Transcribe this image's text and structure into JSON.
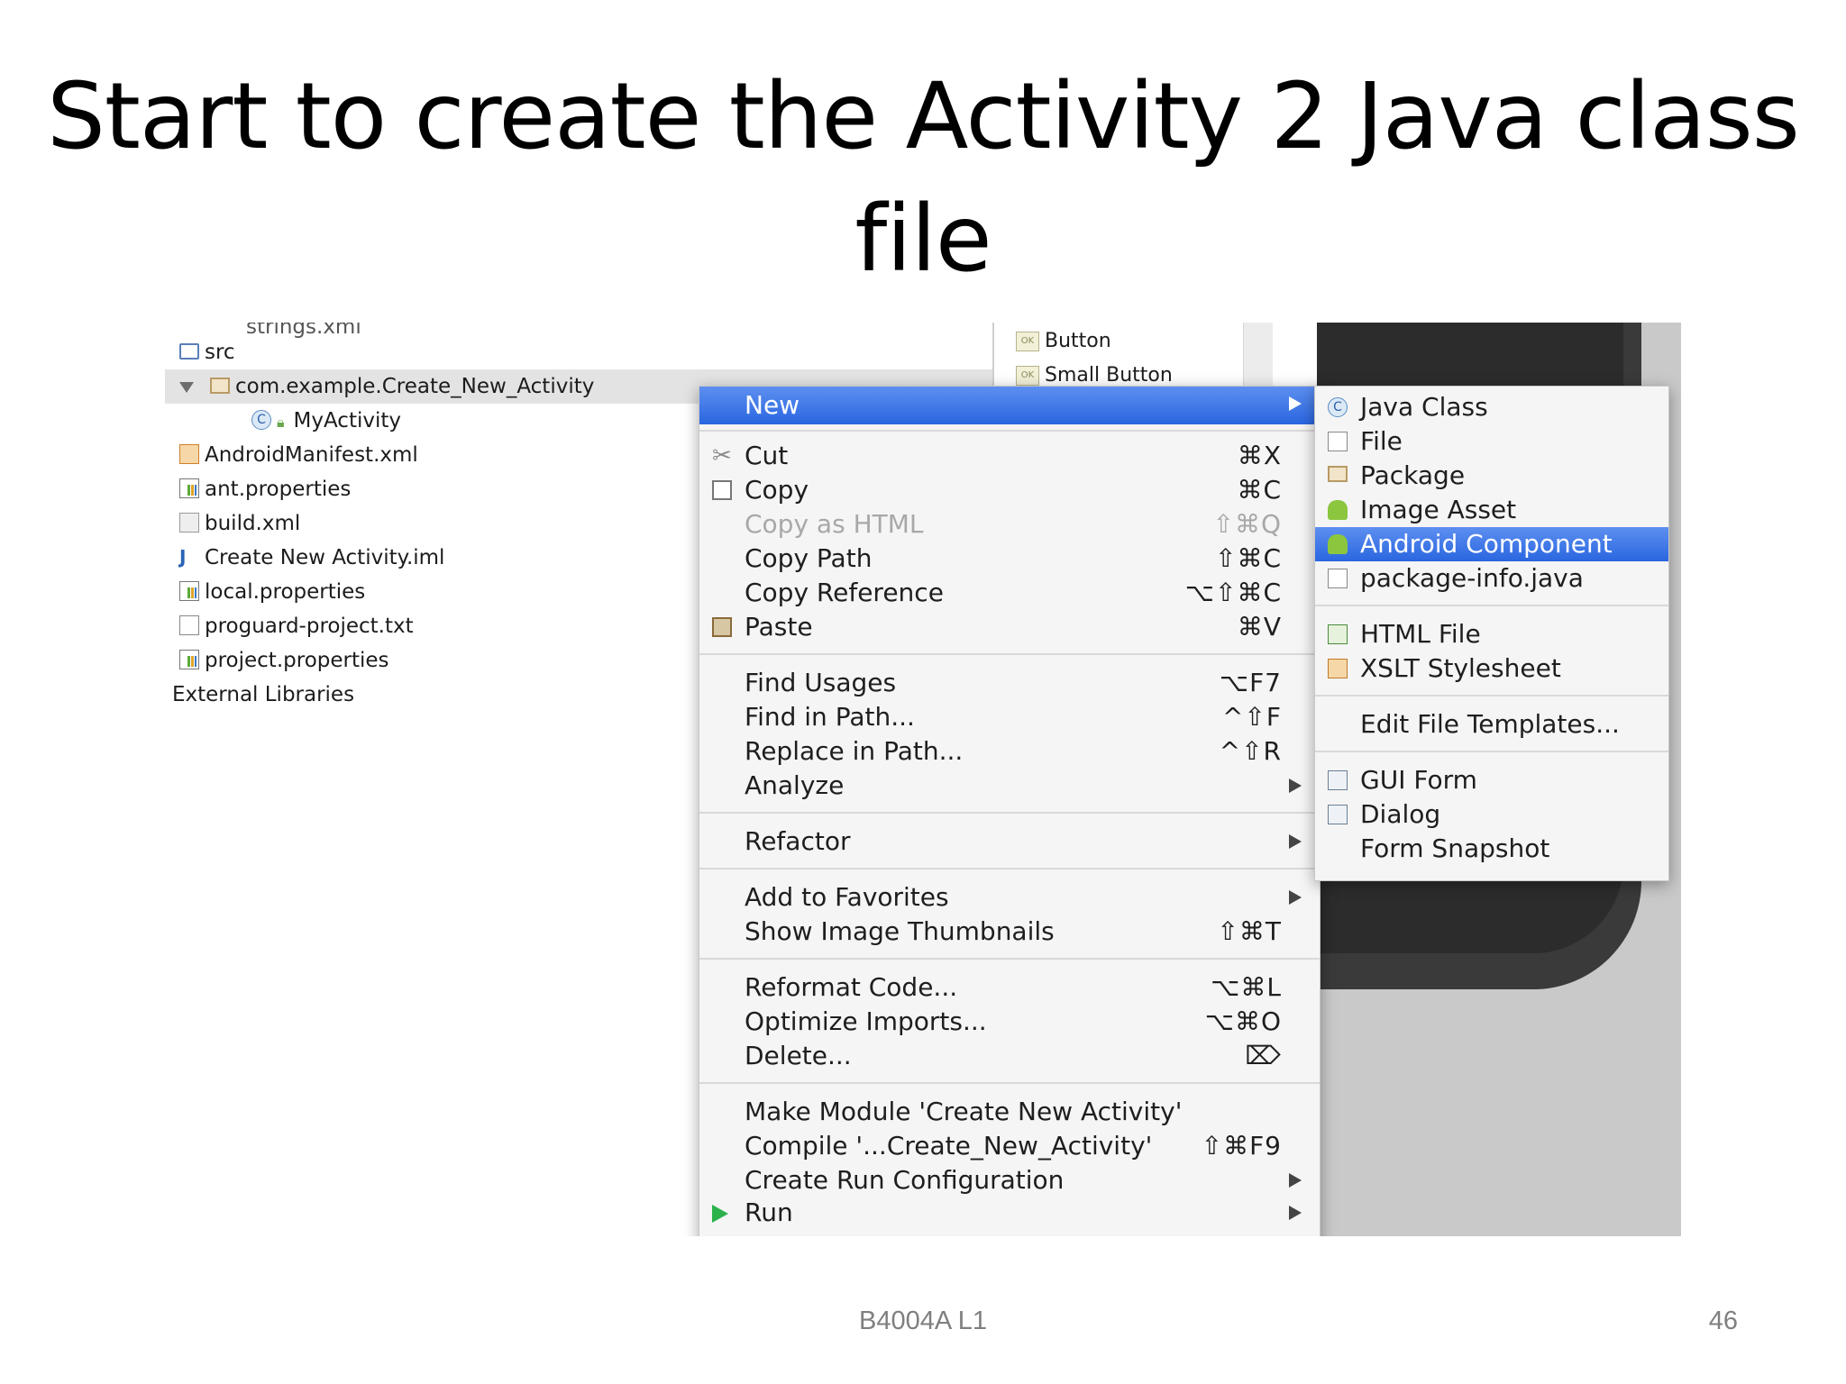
{
  "slide": {
    "title_line1": "Start to create the Activity 2 Java class",
    "title_line2": "file",
    "footer": "B4004A L1",
    "page_number": "46"
  },
  "tree": {
    "partial_top": "strings.xml",
    "src": "src",
    "package": "com.example.Create_New_Activity",
    "activity": "MyActivity",
    "manifest": "AndroidManifest.xml",
    "ant": "ant.properties",
    "build": "build.xml",
    "iml": "Create New Activity.iml",
    "local": "local.properties",
    "proguard": "proguard-project.txt",
    "project": "project.properties",
    "external": "External Libraries"
  },
  "palette": {
    "button": "Button",
    "small_button": "Small Button",
    "ok_badge": "OK"
  },
  "menu": {
    "new": "New",
    "cut": "Cut",
    "cut_sc": "⌘X",
    "copy": "Copy",
    "copy_sc": "⌘C",
    "copy_html": "Copy as HTML",
    "copy_html_sc": "⇧⌘Q",
    "copy_path": "Copy Path",
    "copy_path_sc": "⇧⌘C",
    "copy_ref": "Copy Reference",
    "copy_ref_sc": "⌥⇧⌘C",
    "paste": "Paste",
    "paste_sc": "⌘V",
    "find_usages": "Find Usages",
    "find_usages_sc": "⌥F7",
    "find_in_path": "Find in Path...",
    "find_in_path_sc": "^⇧F",
    "replace_in_path": "Replace in Path...",
    "replace_in_path_sc": "^⇧R",
    "analyze": "Analyze",
    "refactor": "Refactor",
    "add_favorites": "Add to Favorites",
    "show_thumbs": "Show Image Thumbnails",
    "show_thumbs_sc": "⇧⌘T",
    "reformat": "Reformat Code...",
    "reformat_sc": "⌥⌘L",
    "optimize": "Optimize Imports...",
    "optimize_sc": "⌥⌘O",
    "delete": "Delete...",
    "delete_sc": "⌦",
    "make_module": "Make Module 'Create New Activity'",
    "compile": "Compile '...Create_New_Activity'",
    "compile_sc": "⇧⌘F9",
    "create_run": "Create Run Configuration",
    "run": "Run"
  },
  "submenu": {
    "java_class": "Java Class",
    "file": "File",
    "package": "Package",
    "image_asset": "Image Asset",
    "android_component": "Android Component",
    "package_info": "package-info.java",
    "html_file": "HTML File",
    "xslt": "XSLT Stylesheet",
    "edit_templates": "Edit File Templates...",
    "gui_form": "GUI Form",
    "dialog": "Dialog",
    "form_snapshot": "Form Snapshot"
  }
}
